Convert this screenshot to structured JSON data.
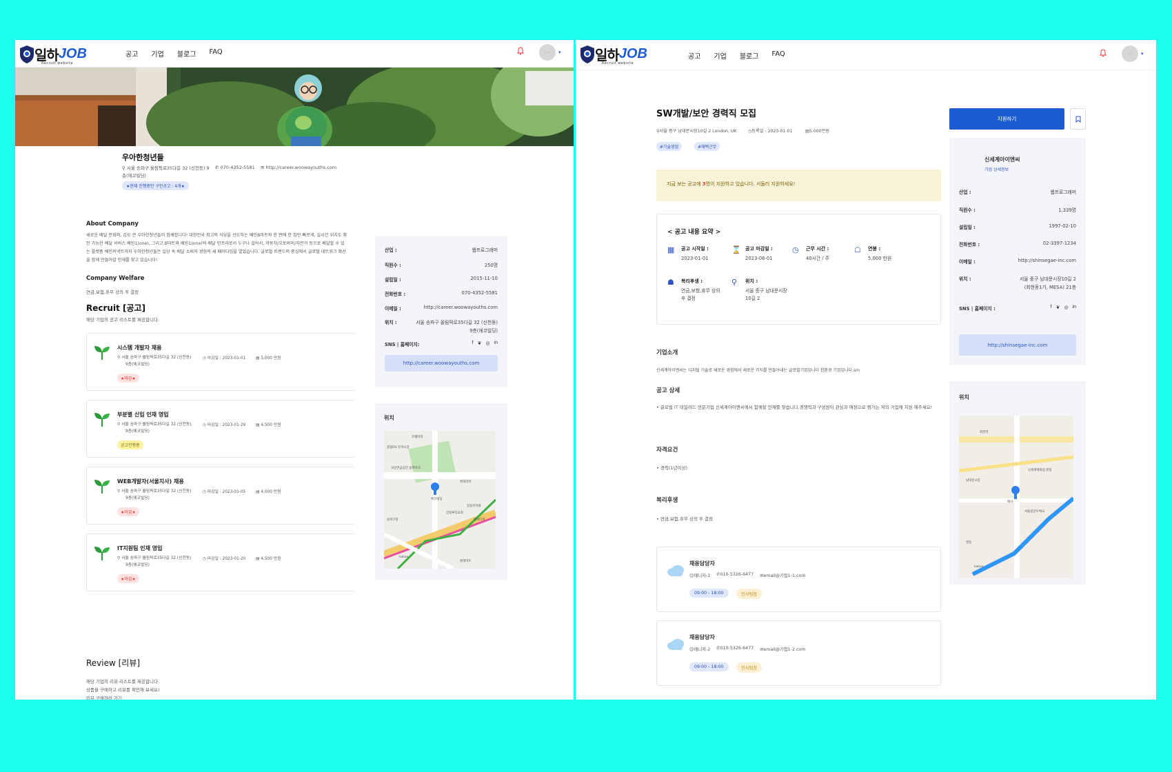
{
  "colors": {
    "background": "#1cfff0",
    "brand_blue": "#1e5bd6",
    "apply_blue": "#1b5cd3",
    "warning_bg": "#f8f3d8",
    "deadline_red": "#e53935",
    "chip_blue": "#dfe7fa"
  },
  "left": {
    "nav": {
      "logo_ko": "일하",
      "logo_en": "JOB",
      "logo_sub": "Recruit website",
      "items": [
        "공고",
        "기업",
        "블로그",
        "FAQ"
      ],
      "avatar": "···"
    },
    "company": {
      "name": "우아한청년들",
      "address": "서울 송파구 올림픽로35다길 32 (신천동) 9층(에코빌딩)",
      "phone": "070-4352-5581",
      "website": "http://career.woowayouths.com",
      "badge": "★현재 진행중인 구인공고 : 4개★"
    },
    "about": {
      "title": "About Company",
      "text": "새로운 배달 문화와, 감도 큰 우아한청년들이 함께합니다! 대한민국 최고의 식당을 선도하는 배민B마트와 한 번에 한 집만 빠르게, 실시간 위치도 확인 가능한 배달 서비스 배민1(one), 그리고 B마트와 배민1(one)의 배달 인프라로서 누구나 걸어서, 자동차/오토바이/자전거 등으로 배달할 수 있는 플랫폼 배민커넥트까지 우아한청년들은 일상 속 배달 소비자 경험의 새 패러다임을 열었습니다. 글로벌 트렌드의 중심에서 글로벌 네트워크 확산을 함께 만들어갈 인재를 찾고 있습니다!"
    },
    "welfare": {
      "title": "Company Welfare",
      "text": "연금,보험,휴무 상의 후 결정"
    },
    "recruit": {
      "title": "Recruit [공고]",
      "subtitle": "해당 기업의 공고 리스트를 제공합니다.",
      "jobs": [
        {
          "title": "시스템 개발자 채용",
          "addr1": "서울 송파구 올림픽로35다길 32 (신천동)",
          "addr2": "9층(에코빌딩)",
          "deadline": "마감일 : 2023-01-01",
          "salary": "5,000 만원",
          "status": "★마감★",
          "status_color": "#e53935",
          "status_bg": "#fde2e2"
        },
        {
          "title": "부분별 신입 인재 영입",
          "addr1": "서울 송파구 올림픽로35다길 32 (신천동)",
          "addr2": "9층(에코빌딩)",
          "deadline": "마감일 : 2023-01-29",
          "salary": "4,500 만원",
          "status": "공고진행중",
          "status_color": "#7a6a00",
          "status_bg": "#fbf3a0"
        },
        {
          "title": "WEB개발자(서울지사) 채용",
          "addr1": "서울 송파구 올림픽로35다길 32 (신천동)",
          "addr2": "9층(에코빌딩)",
          "deadline": "마감일 : 2023-01-05",
          "salary": "4,000 만원",
          "status": "★마감★",
          "status_color": "#e53935",
          "status_bg": "#fde2e2"
        },
        {
          "title": "IT지원팀 인재 영입",
          "addr1": "서울 송파구 올림픽로35다길 32 (신천동)",
          "addr2": "9층(에코빌딩)",
          "deadline": "마감일 : 2023-01-20",
          "salary": "4,500 만원",
          "status": "★마감★",
          "status_color": "#e53935",
          "status_bg": "#fde2e2"
        }
      ]
    },
    "review": {
      "title": "Review [리뷰]",
      "line1": "해당 기업의 리뷰 리스트를 제공합니다.",
      "line2": "상품을 구매하고 리뷰를 확인해 보세요!",
      "line3": "리뷰 구매하러 가기"
    },
    "info": {
      "rows": [
        {
          "k": "산업 :",
          "v": "웹프로그래머"
        },
        {
          "k": "직원수 :",
          "v": "250명"
        },
        {
          "k": "설립일 :",
          "v": "2015-11-10"
        },
        {
          "k": "전화번호 :",
          "v": "070-4352-5581"
        },
        {
          "k": "이메일 :",
          "v": "http://career.woowayouths.com"
        },
        {
          "k": "위치 :",
          "v": "서울 송파구 올림픽로35다길 32 (신천동)",
          "v2": "9층(에코빌딩)"
        }
      ],
      "sns_label": "SNS | 홈페이지:",
      "link": "http://career.woowayouths.com"
    },
    "map": {
      "title": "위치",
      "labels": [
        "호텔마리",
        "종합DS 유학시장",
        "국민연금공단 송파지사",
        "롯데리아",
        "에코빌딩",
        "잠실유아원",
        "롯데타워",
        "잠실루터교회",
        "송파구청",
        "kakao",
        "롯데마트"
      ]
    }
  },
  "right": {
    "nav": {
      "logo_ko": "일하",
      "logo_en": "JOB",
      "logo_sub": "Recruit website",
      "items": [
        "공고",
        "기업",
        "블로그",
        "FAQ"
      ],
      "avatar": "···"
    },
    "job": {
      "title": "SW개발/보안 경력직 모집",
      "location": "서울 중구 남대문시장10길 2 London, UK",
      "reg": "등록일 : 2023-01-01",
      "salary": "5,000만원",
      "tags": [
        "#기술영업",
        "#재택근무"
      ]
    },
    "notice": {
      "pre": "지금 보는 공고에 ",
      "num": "3",
      "post": "명이 지원하고 있습니다. 서둘러 지원하세요!"
    },
    "summary": {
      "title": "< 공고 내용 요약 >",
      "items": [
        {
          "label": "공고 시작일 :",
          "value": "2023-01-01"
        },
        {
          "label": "공고 마감일 :",
          "value": "2023-06-01"
        },
        {
          "label": "근무 시간 :",
          "value": "40시간 / 주"
        },
        {
          "label": "연봉 :",
          "value": "5,000 만원"
        },
        {
          "label": "복리후생 :",
          "value": "연금,보험,휴무 상의 후 결정"
        },
        {
          "label": "위치 :",
          "value": "서울 중구 남대문시장10길 2"
        }
      ]
    },
    "intro": {
      "title": "기업소개",
      "text": "신세계아이앤씨는 디지털 기술로 새로운 경험에서 새로운 가치를 만들어내는 글로벌기업입니다 친환경 기업입니다.sm"
    },
    "detail": {
      "title": "공고 상세",
      "text": "글로벌 IT 테일러드 전문기업 신세계아이앤씨에서 함께할 인재를 찾습니다.경쟁력과 구성원이 관심과 애정으로 평가는 저의 기업에 지원 해주세요!"
    },
    "req": {
      "title": "자격요건",
      "text": "경력(1년이상)"
    },
    "welfare": {
      "title": "복리후생",
      "text": "연금,보험,휴무 상의 후 결정"
    },
    "contacts": [
      {
        "title": "채용담당자",
        "name": "매니저-1",
        "phone": "010-5326-6477",
        "email": "email@기업1-1.com",
        "hours": "09:00 - 18:00",
        "dept": "인사팀장"
      },
      {
        "title": "채용담당자",
        "name": "매니저-2",
        "phone": "010-5326-6477",
        "email": "email@기업1-2.com",
        "hours": "09:00 - 18:00",
        "dept": "인사팀장"
      }
    ],
    "apply": "지원하기",
    "company_card": {
      "name": "신세계아이앤씨",
      "link": "기업 상세정보",
      "rows": [
        {
          "k": "산업 :",
          "v": "웹프로그래머"
        },
        {
          "k": "직원수 :",
          "v": "1,339명"
        },
        {
          "k": "설립일 :",
          "v": "1997-02-10"
        },
        {
          "k": "전화번호 :",
          "v": "02-3397-1234"
        },
        {
          "k": "이메일 :",
          "v": "http://shinsegae-inc.com"
        },
        {
          "k": "위치 :",
          "v": "서울 중구 남대문시장10길 2",
          "v2": "(회현동1가, MESA) 21층"
        }
      ],
      "sns_label": "SNS | 홈페이지 :",
      "homepage": "http://shinsegae-inc.com"
    },
    "map": {
      "title": "위치",
      "labels": [
        "회현역",
        "신세계백화점 본점",
        "메사",
        "남대문시장",
        "서울중앙우체국",
        "명동",
        "kakao"
      ]
    }
  }
}
